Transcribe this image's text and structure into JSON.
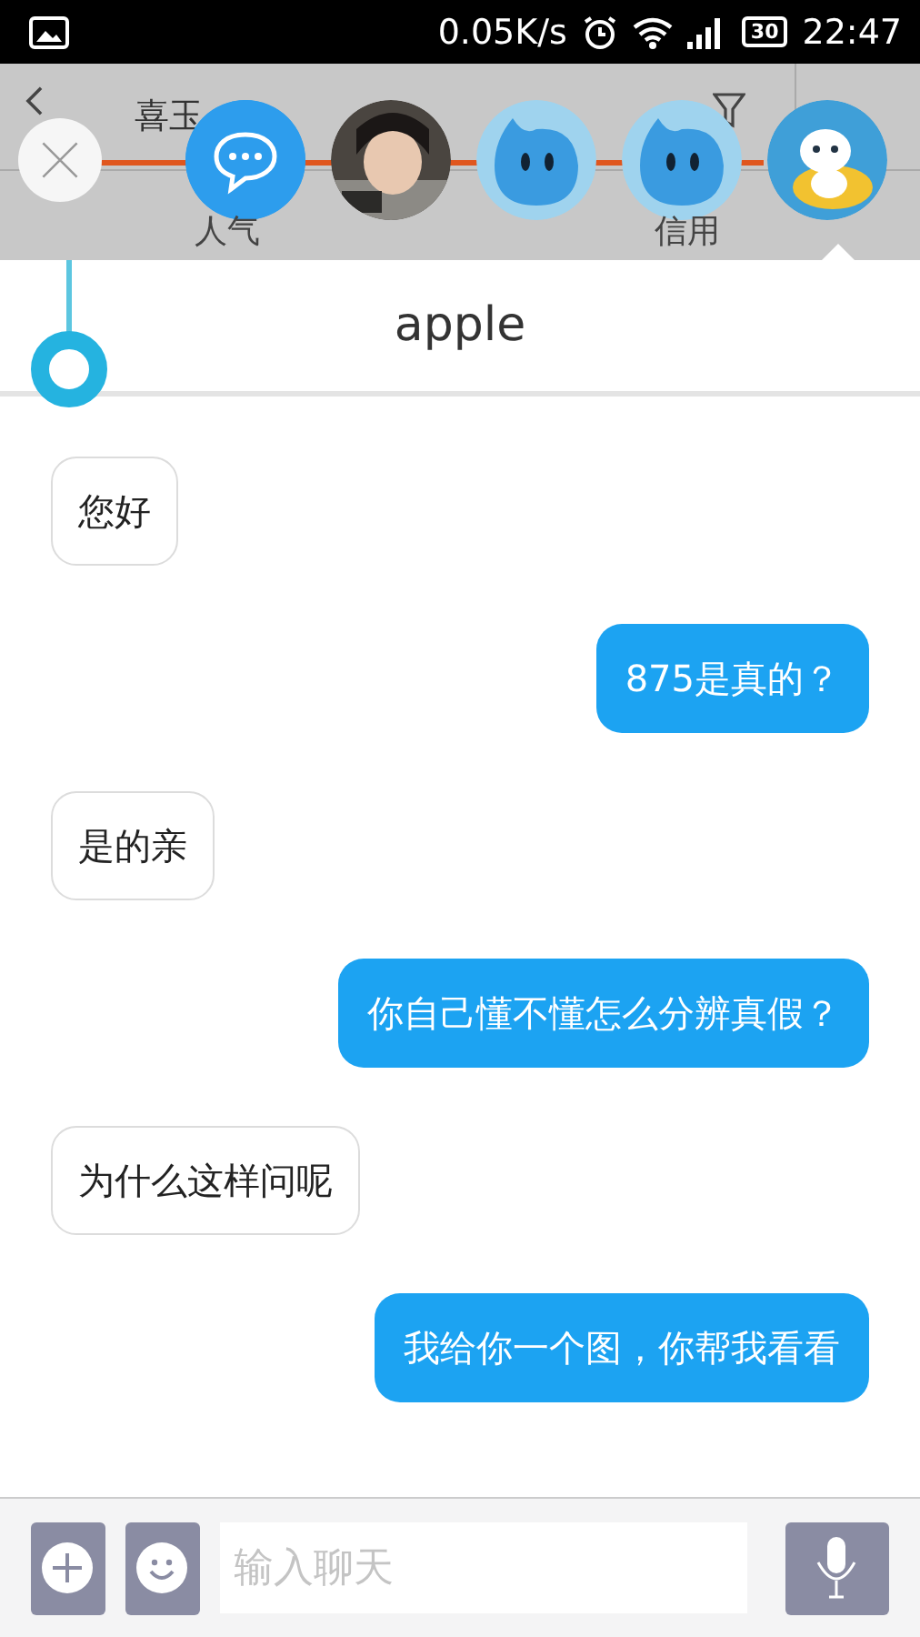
{
  "status_bar": {
    "speed": "0.05K/s",
    "battery": "30",
    "time": "22:47"
  },
  "header": {
    "title": "喜玉",
    "labels": [
      "人气",
      "信用"
    ]
  },
  "chat": {
    "title": "apple",
    "messages": [
      {
        "kind": "received",
        "text": "您好"
      },
      {
        "kind": "sent",
        "text": "875是真的？"
      },
      {
        "kind": "received",
        "text": "是的亲"
      },
      {
        "kind": "sent",
        "text": "你自己懂不懂怎么分辨真假？"
      },
      {
        "kind": "received",
        "text": "为什么这样问呢"
      },
      {
        "kind": "sent",
        "text": "我给你一个图，你帮我看看"
      }
    ]
  },
  "input": {
    "placeholder": "输入聊天"
  }
}
